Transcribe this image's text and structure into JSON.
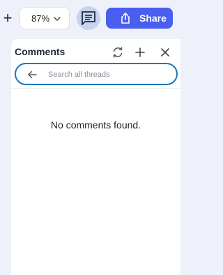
{
  "toolbar": {
    "zoom_in_symbol": "+",
    "zoom_value": "87%",
    "share_label": "Share",
    "icons": {
      "zoom_in": "plus-icon",
      "zoom_dropdown": "chevron-down-icon",
      "comments_toggle": "comment-icon",
      "share": "share-upload-icon"
    }
  },
  "comments_panel": {
    "title": "Comments",
    "search_placeholder": "Search all threads",
    "search_value": "",
    "empty_message": "No comments found.",
    "icons": {
      "refresh": "refresh-icon",
      "add": "add-icon",
      "close": "close-icon",
      "back": "arrow-left-icon"
    }
  },
  "colors": {
    "accent": "#4a5ef0",
    "search_border": "#1a78b8",
    "toggle_active_bg": "#c8d3f1",
    "app_bg": "#eef1fa"
  }
}
